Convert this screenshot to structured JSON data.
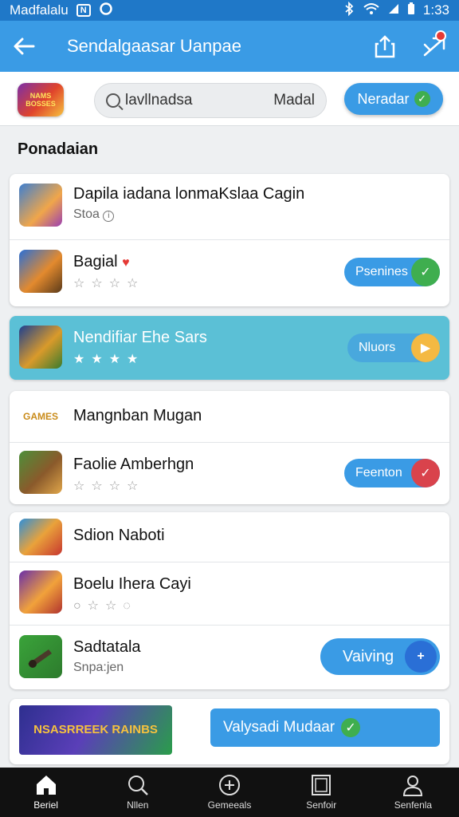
{
  "status_bar": {
    "carrier": "Madfalalu",
    "time": "1:33"
  },
  "app_bar": {
    "title": "Sendalgaasar Uanpae"
  },
  "search": {
    "logo_text": "NAMS BOSSES",
    "query": "lavllnadsa",
    "scope": "Madal"
  },
  "filter_button": {
    "label": "Neradar"
  },
  "section": {
    "title": "Ponadaian"
  },
  "cards": [
    {
      "rows": [
        {
          "name": "Dapila iadana lonmaKslaa Cagin",
          "sub": "Stoa"
        },
        {
          "name": "Bagial",
          "rating": "0 of 4",
          "button": "Psenines"
        }
      ]
    },
    {
      "rows": [
        {
          "name": "Nendifiar Ehe Sars",
          "rating": "4 of 4",
          "button": "Nluors"
        }
      ]
    },
    {
      "rows": [
        {
          "name": "Mangnban Mugan",
          "thumb_text": "GAMES"
        },
        {
          "name": "Faolie Amberhgn",
          "rating": "0 of 4",
          "button": "Feenton"
        }
      ]
    },
    {
      "rows": [
        {
          "name": "Sdion Naboti"
        },
        {
          "name": "Boelu Ihera Cayi",
          "rating": "0 of 4"
        },
        {
          "name": "Sadtatala",
          "sub": "Snpa:jen",
          "button": "Vaiving"
        }
      ]
    },
    {
      "rows": [
        {
          "banner_text": "NSASRREEK RAINBS",
          "button": "Valysadi Mudaar"
        }
      ]
    }
  ],
  "tab_bar": [
    {
      "label": "Beriel",
      "icon": "home-icon"
    },
    {
      "label": "Nllen",
      "icon": "search-icon"
    },
    {
      "label": "Gemeeals",
      "icon": "compass-icon"
    },
    {
      "label": "Senfoir",
      "icon": "square-icon"
    },
    {
      "label": "Senfenla",
      "icon": "person-icon"
    }
  ],
  "colors": {
    "primary": "#3a9be5",
    "status_bar": "#1f78c8",
    "highlight_card": "#5bc0d6",
    "check_green": "#3fae4f",
    "play_yellow": "#f4b942",
    "cancel_red": "#d9434c",
    "download_blue": "#2a6fd6"
  }
}
